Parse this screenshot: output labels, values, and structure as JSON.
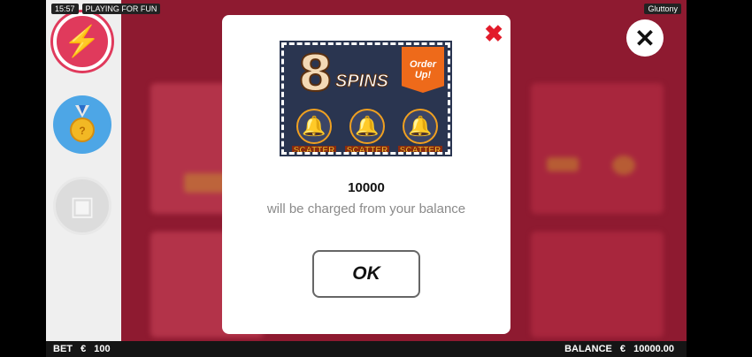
{
  "status": {
    "time": "15:57",
    "mode": "PLAYING FOR FUN",
    "game_name": "Gluttony"
  },
  "sidebar": {
    "items": [
      {
        "icon": "lightning-icon"
      },
      {
        "icon": "medal-icon"
      },
      {
        "icon": "treasure-chest-icon"
      }
    ]
  },
  "modal": {
    "promo": {
      "count": "8",
      "label": "SPINS",
      "tag": "Order Up!",
      "scatter_labels": [
        "SCATTER",
        "SCATTER",
        "SCATTER"
      ]
    },
    "amount": "10000",
    "message": "will be charged from your balance",
    "ok_label": "OK"
  },
  "footer": {
    "bet_label": "BET",
    "bet_currency": "€",
    "bet_value": "100",
    "balance_label": "BALANCE",
    "balance_currency": "€",
    "balance_value": "10000.00"
  }
}
